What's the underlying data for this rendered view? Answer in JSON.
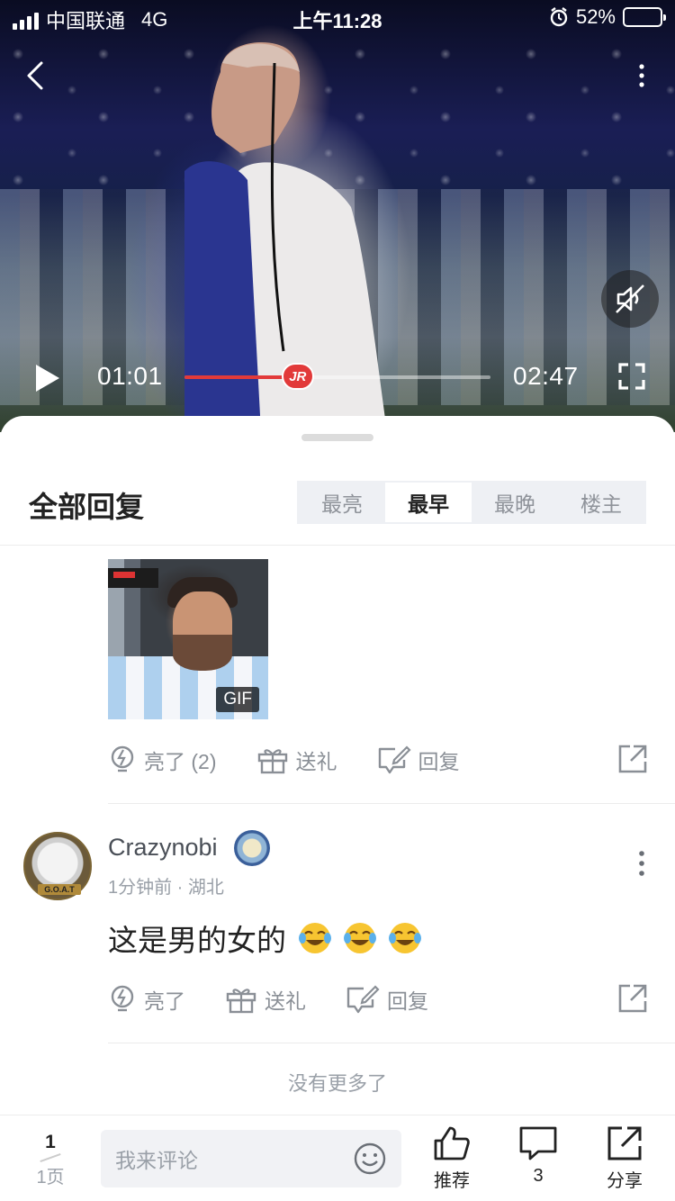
{
  "status_bar": {
    "carrier": "中国联通",
    "network": "4G",
    "time": "上午11:28",
    "battery": "52%"
  },
  "video": {
    "current_time": "01:01",
    "total_time": "02:47",
    "progress": 0.37,
    "thumb_label": "JR"
  },
  "replies": {
    "title": "全部回复",
    "sort_tabs": [
      "最亮",
      "最早",
      "最晚",
      "楼主"
    ],
    "active_tab": "最早"
  },
  "first_comment": {
    "gif_badge": "GIF",
    "actions": {
      "like": "亮了 (2)",
      "gift": "送礼",
      "reply": "回复"
    }
  },
  "second_comment": {
    "username": "Crazynobi",
    "meta": "1分钟前 · 湖北",
    "text": "这是男的女的",
    "avatar_caption": "G.O.A.T",
    "actions": {
      "like": "亮了",
      "gift": "送礼",
      "reply": "回复"
    }
  },
  "footer_note": "没有更多了",
  "bottom_bar": {
    "page_current": "1",
    "page_label": "1页",
    "comment_placeholder": "我来评论",
    "recommend_label": "推荐",
    "comments_count": "3",
    "share_label": "分享"
  },
  "colors": {
    "accent_red": "#e23a3a",
    "muted_text": "#8a8f96",
    "tab_bg": "#eef0f4"
  }
}
